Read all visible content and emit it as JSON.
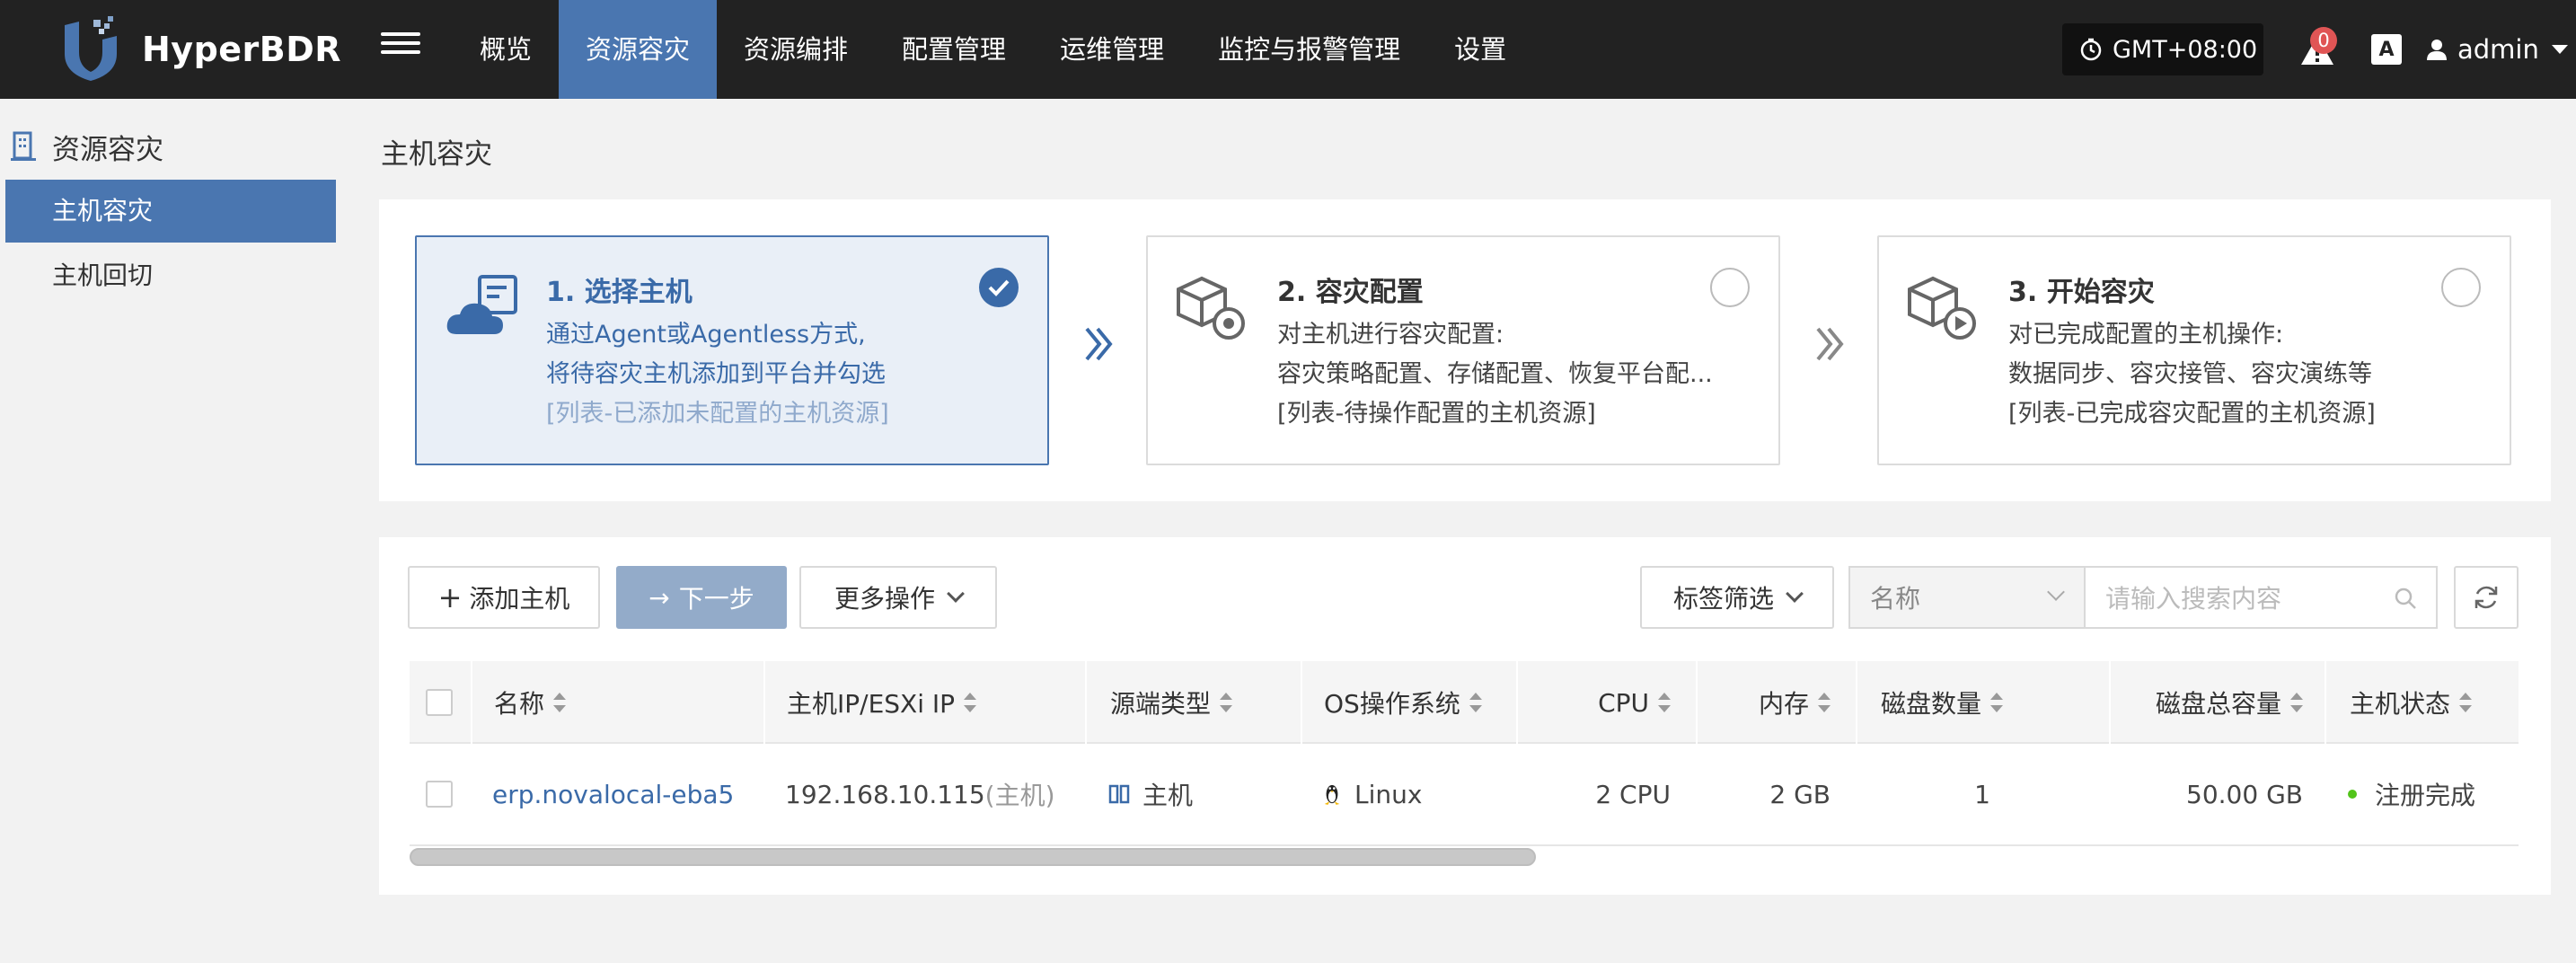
{
  "app": {
    "name": "HyperBDR"
  },
  "nav": {
    "items": [
      {
        "label": "概览"
      },
      {
        "label": "资源容灾"
      },
      {
        "label": "资源编排"
      },
      {
        "label": "配置管理"
      },
      {
        "label": "运维管理"
      },
      {
        "label": "监控与报警管理"
      },
      {
        "label": "设置"
      }
    ],
    "active_index": 1,
    "timezone": "GMT+08:00",
    "alert_count": "0",
    "lang_icon_text": "A",
    "user": "admin"
  },
  "sidebar": {
    "title": "资源容灾",
    "items": [
      {
        "label": "主机容灾"
      },
      {
        "label": "主机回切"
      }
    ],
    "active_index": 0
  },
  "main": {
    "title": "主机容灾",
    "steps": [
      {
        "title": "1. 选择主机",
        "lines": [
          "通过Agent或Agentless方式,",
          "将待容灾主机添加到平台并勾选"
        ],
        "hint": "[列表-已添加未配置的主机资源]",
        "done": true
      },
      {
        "title": "2. 容灾配置",
        "lines": [
          "对主机进行容灾配置:",
          "容灾策略配置、存储配置、恢复平台配..."
        ],
        "hint": "[列表-待操作配置的主机资源]",
        "done": false
      },
      {
        "title": "3. 开始容灾",
        "lines": [
          "对已完成配置的主机操作:",
          "数据同步、容灾接管、容灾演练等"
        ],
        "hint": "[列表-已完成容灾配置的主机资源]",
        "done": false
      }
    ],
    "toolbar": {
      "add_host": "添加主机",
      "next_step": "下一步",
      "more_actions": "更多操作",
      "tag_filter": "标签筛选",
      "search_field": "名称",
      "search_placeholder": "请输入搜索内容"
    },
    "table": {
      "columns": [
        "名称",
        "主机IP/ESXi IP",
        "源端类型",
        "OS操作系统",
        "CPU",
        "内存",
        "磁盘数量",
        "磁盘总容量",
        "主机状态"
      ],
      "rows": [
        {
          "name": "erp.novalocal-eba5",
          "ip": "192.168.10.115",
          "ip_note": "(主机)",
          "source_type": "主机",
          "os": "Linux",
          "cpu": "2 CPU",
          "memory": "2 GB",
          "disk_count": "1",
          "disk_total": "50.00 GB",
          "status": "注册完成"
        }
      ]
    }
  },
  "colors": {
    "accent": "#4a76b0",
    "topbar": "#222222",
    "status_ok": "#52c41a"
  }
}
